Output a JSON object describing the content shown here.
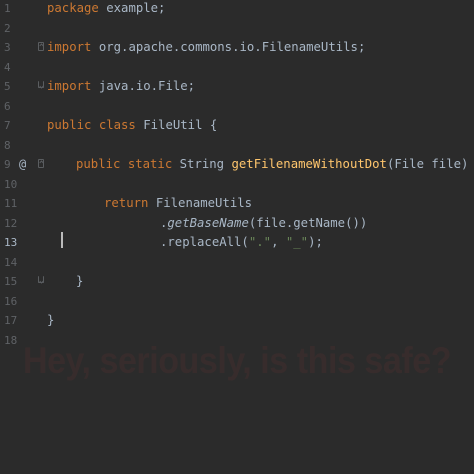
{
  "gutter": {
    "line_numbers": [
      "1",
      "2",
      "3",
      "4",
      "5",
      "6",
      "7",
      "8",
      "9",
      "10",
      "11",
      "12",
      "13",
      "14",
      "15",
      "16",
      "17",
      "18"
    ],
    "current_line": "13",
    "annotation_line9": "@"
  },
  "code": {
    "l1_kw": "package",
    "l1_rest": " example;",
    "l3_kw": "import",
    "l3_rest": " org.apache.commons.io.FilenameUtils;",
    "l5_kw": "import",
    "l5_rest": " java.io.File;",
    "l7_kw": "public class",
    "l7_rest": " FileUtil {",
    "l9_kw": "public static",
    "l9_type": " String ",
    "l9_fn": "getFilenameWithoutDot",
    "l9_rest": "(File file) {",
    "l11_kw": "return",
    "l11_rest": " FilenameUtils",
    "l12_dot": ".",
    "l12_method": "getBaseName",
    "l12_rest": "(file.getName())",
    "l13_pre": ".replaceAll(",
    "l13_s1": "\".\"",
    "l13_mid": ", ",
    "l13_s2": "\"_\"",
    "l13_post": ");",
    "l15": "}",
    "l17": "}"
  },
  "overlay": {
    "caption": "Hey, seriously, is this safe?"
  }
}
